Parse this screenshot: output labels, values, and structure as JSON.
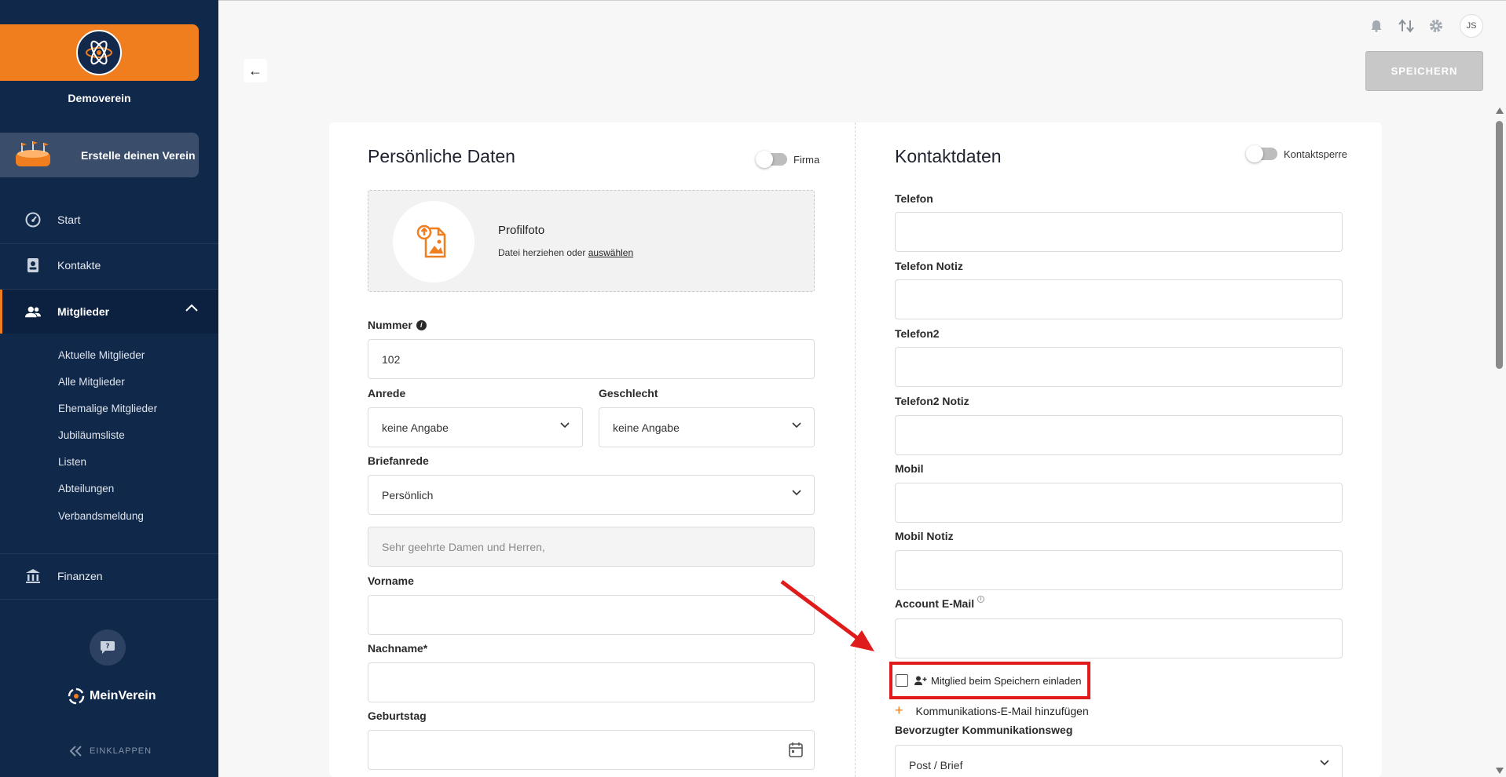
{
  "sidebar": {
    "club_name": "Demoverein",
    "create_club": "Erstelle deinen Verein",
    "nav": {
      "start": "Start",
      "contacts": "Kontakte",
      "members": "Mitglieder",
      "finances": "Finanzen"
    },
    "sub_items": [
      "Aktuelle Mitglieder",
      "Alle Mitglieder",
      "Ehemalige Mitglieder",
      "Jubiläumsliste",
      "Listen",
      "Abteilungen",
      "Verbandsmeldung"
    ],
    "brand": "MeinVerein",
    "collapse": "EINKLAPPEN"
  },
  "topbar": {
    "avatar_initials": "JS",
    "save": "SPEICHERN",
    "back": "←"
  },
  "personal": {
    "title": "Persönliche Daten",
    "company_toggle": "Firma",
    "photo_title": "Profilfoto",
    "photo_hint": "Datei herziehen oder",
    "photo_link": "auswählen",
    "number_label": "Nummer",
    "number_value": "102",
    "salutation_label": "Anrede",
    "salutation_value": "keine Angabe",
    "gender_label": "Geschlecht",
    "gender_value": "keine Angabe",
    "letter_label": "Briefanrede",
    "letter_value": "Persönlich",
    "letter_text_placeholder": "Sehr geehrte Damen und Herren,",
    "firstname_label": "Vorname",
    "lastname_label": "Nachname*",
    "birthday_label": "Geburtstag"
  },
  "contact": {
    "title": "Kontaktdaten",
    "block_toggle": "Kontaktsperre",
    "phone_label": "Telefon",
    "phone_note_label": "Telefon Notiz",
    "phone2_label": "Telefon2",
    "phone2_note_label": "Telefon2 Notiz",
    "mobile_label": "Mobil",
    "mobile_note_label": "Mobil Notiz",
    "account_email_label": "Account E-Mail",
    "invite_label": "Mitglied beim Speichern einladen",
    "add_comm_email": "Kommunikations-E-Mail hinzufügen",
    "preferred_comm_label": "Bevorzugter Kommunikationsweg",
    "preferred_comm_value": "Post / Brief"
  },
  "colors": {
    "sidebar_bg": "#10284a",
    "accent": "#f07d1e",
    "highlight": "#e01b1b"
  }
}
